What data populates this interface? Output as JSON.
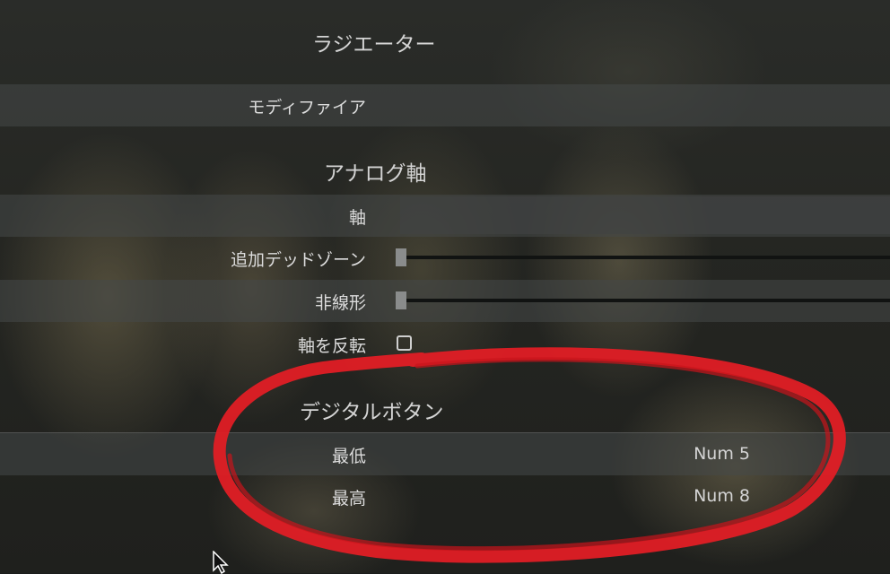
{
  "sections": {
    "radiator": "ラジエーター",
    "analog_axis": "アナログ軸",
    "digital_buttons": "デジタルボタン"
  },
  "rows": {
    "modifier": "モディファイア",
    "axis": "軸",
    "additional_deadzone": "追加デッドゾーン",
    "nonlinearity": "非線形",
    "invert_axis": "軸を反転",
    "min": {
      "label": "最低",
      "value": "Num 5"
    },
    "max": {
      "label": "最高",
      "value": "Num 8"
    }
  },
  "sliders": {
    "additional_deadzone": 0,
    "nonlinearity": 0
  },
  "invert_axis_checked": false,
  "colors": {
    "annotation": "#e01e25"
  }
}
